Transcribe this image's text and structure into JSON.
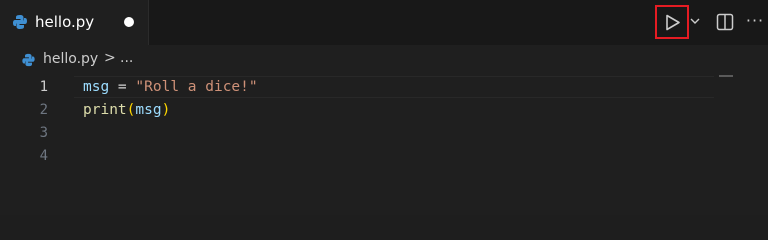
{
  "tab": {
    "filename": "hello.py",
    "unsaved": true
  },
  "actions": {
    "run_icon": "play-icon",
    "dropdown_icon": "chevron-down-icon",
    "split_icon": "split-editor-icon",
    "more_label": "···"
  },
  "breadcrumb": {
    "file": "hello.py",
    "separator": ">",
    "more": "..."
  },
  "editor": {
    "line_numbers": [
      "1",
      "2",
      "3",
      "4"
    ],
    "active_line": 1,
    "lines": [
      [
        {
          "text": "msg",
          "kind": "var"
        },
        {
          "text": " = ",
          "kind": "op"
        },
        {
          "text": "\"Roll a dice!\"",
          "kind": "str"
        }
      ],
      [
        {
          "text": "print",
          "kind": "fn"
        },
        {
          "text": "(",
          "kind": "paren"
        },
        {
          "text": "msg",
          "kind": "var"
        },
        {
          "text": ")",
          "kind": "paren"
        }
      ],
      [],
      []
    ]
  },
  "colors": {
    "background": "#1e1e1e",
    "run_highlight": "#e51c23",
    "python_blue": "#3f8fd2",
    "string": "#ce9178",
    "variable": "#9cdcfe",
    "function": "#dcdcaa"
  }
}
